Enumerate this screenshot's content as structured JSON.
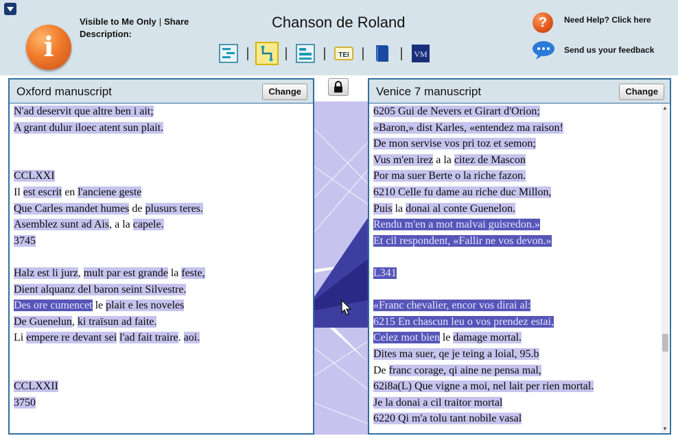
{
  "header": {
    "visibility": "Visible to Me Only",
    "share": "Share",
    "description_label": "Description:",
    "title": "Chanson de Roland",
    "help": "Need Help? Click here",
    "feedback": "Send us your feedback",
    "tei_label": "TEI",
    "vm_label": "VM"
  },
  "left_panel": {
    "title": "Oxford manuscript",
    "change": "Change",
    "lines": [
      [
        {
          "t": "N'ad deservit que altre ben i ait;",
          "s": "hl"
        }
      ],
      [
        {
          "t": "A grant dulur iloec atent sun plait.",
          "s": "hl"
        }
      ],
      [],
      [],
      [
        {
          "t": "CCLXXI",
          "s": "hl"
        }
      ],
      [
        {
          "t": "Il ",
          "s": ""
        },
        {
          "t": "est escrit",
          "s": "hl"
        },
        {
          "t": " en ",
          "s": ""
        },
        {
          "t": "l'anciene geste",
          "s": "hl"
        }
      ],
      [
        {
          "t": "Que Carles mandet humes",
          "s": "hl"
        },
        {
          "t": " de ",
          "s": ""
        },
        {
          "t": "plusurs teres.",
          "s": "hl"
        }
      ],
      [
        {
          "t": "Asemblez sunt ad Ais",
          "s": "hl"
        },
        {
          "t": ", a la ",
          "s": ""
        },
        {
          "t": "capele.",
          "s": "hl"
        }
      ],
      [
        {
          "t": "3745",
          "s": "hl"
        }
      ],
      [],
      [
        {
          "t": "Halz est li jurz",
          "s": "hl"
        },
        {
          "t": ", ",
          "s": ""
        },
        {
          "t": "mult par est grande",
          "s": "hl"
        },
        {
          "t": " la ",
          "s": ""
        },
        {
          "t": "feste,",
          "s": "hl"
        }
      ],
      [
        {
          "t": "Dient alquanz del baron seint Silvestre.",
          "s": "hl"
        }
      ],
      [
        {
          "t": "Des ore cumencet",
          "s": "dk"
        },
        {
          "t": " le ",
          "s": ""
        },
        {
          "t": "plait e les noveles",
          "s": "hl"
        }
      ],
      [
        {
          "t": "De Guenelun",
          "s": "hl"
        },
        {
          "t": ", ",
          "s": ""
        },
        {
          "t": "ki traïsun ad faite.",
          "s": "hl"
        }
      ],
      [
        {
          "t": "Li ",
          "s": ""
        },
        {
          "t": "empere re devant sei",
          "s": "hl"
        },
        {
          "t": " ",
          "s": ""
        },
        {
          "t": "l'ad fait traire",
          "s": "hl"
        },
        {
          "t": ". ",
          "s": ""
        },
        {
          "t": "aoi.",
          "s": "hl"
        }
      ],
      [],
      [],
      [
        {
          "t": "CCLXXII",
          "s": "hl"
        }
      ],
      [
        {
          "t": "3750",
          "s": "hl"
        }
      ]
    ]
  },
  "right_panel": {
    "title": "Venice 7 manuscript",
    "change": "Change",
    "lines": [
      [
        {
          "t": "6205 Gui de Nevers et Girart d'Orion;",
          "s": "hl"
        }
      ],
      [
        {
          "t": "«Baron,» dist Karles, «entendez ma raison!",
          "s": "hl"
        }
      ],
      [
        {
          "t": "De mon servise vos pri toz et semon;",
          "s": "hl"
        }
      ],
      [
        {
          "t": "Vus m'en irez",
          "s": "hl"
        },
        {
          "t": " a la ",
          "s": ""
        },
        {
          "t": "citez de Mascon",
          "s": "hl"
        }
      ],
      [
        {
          "t": "Por ma suer Berte o la riche fazon.",
          "s": "hl"
        }
      ],
      [
        {
          "t": "6210 Celle fu dame au riche duc Millon,",
          "s": "hl"
        }
      ],
      [
        {
          "t": "Puis",
          "s": "hl"
        },
        {
          "t": " la ",
          "s": ""
        },
        {
          "t": "donai al conte Guenelon.",
          "s": "hl"
        }
      ],
      [
        {
          "t": "Rendu m'en a mot malvai guisredon.»",
          "s": "dk"
        }
      ],
      [
        {
          "t": "Et cil respondent, «Fallir ne vos devon.»",
          "s": "dk"
        }
      ],
      [],
      [
        {
          "t": "L341",
          "s": "dk"
        }
      ],
      [],
      [
        {
          "t": "«Franc chevalier, encor vos dirai al:",
          "s": "dk"
        }
      ],
      [
        {
          "t": "6215 En chascun leu o vos prendez estai,",
          "s": "dk"
        }
      ],
      [
        {
          "t": "Celez mot bien",
          "s": "dk"
        },
        {
          "t": " le ",
          "s": ""
        },
        {
          "t": "damage mortal.",
          "s": "hl"
        }
      ],
      [
        {
          "t": "Dites ma suer, qe je teing a loial, 95.b",
          "s": "hl"
        }
      ],
      [
        {
          "t": "De ",
          "s": ""
        },
        {
          "t": "franc corage, qi aine ne pensa mal,",
          "s": "hl"
        }
      ],
      [
        {
          "t": "62i8a(L) Que vigne a moi, nel lait per rien mortal.",
          "s": "hl"
        }
      ],
      [
        {
          "t": "Je la donai a cil traitor mortal",
          "s": "hl"
        }
      ],
      [
        {
          "t": "6220 Qi m'a tolu tant nobile vasal",
          "s": "hl"
        }
      ]
    ]
  },
  "colors": {
    "highlight": "#c6c4ee",
    "highlight_dark": "#5656b8",
    "panel_border": "#2f6fa0",
    "header_bg": "#d7e3ea"
  }
}
